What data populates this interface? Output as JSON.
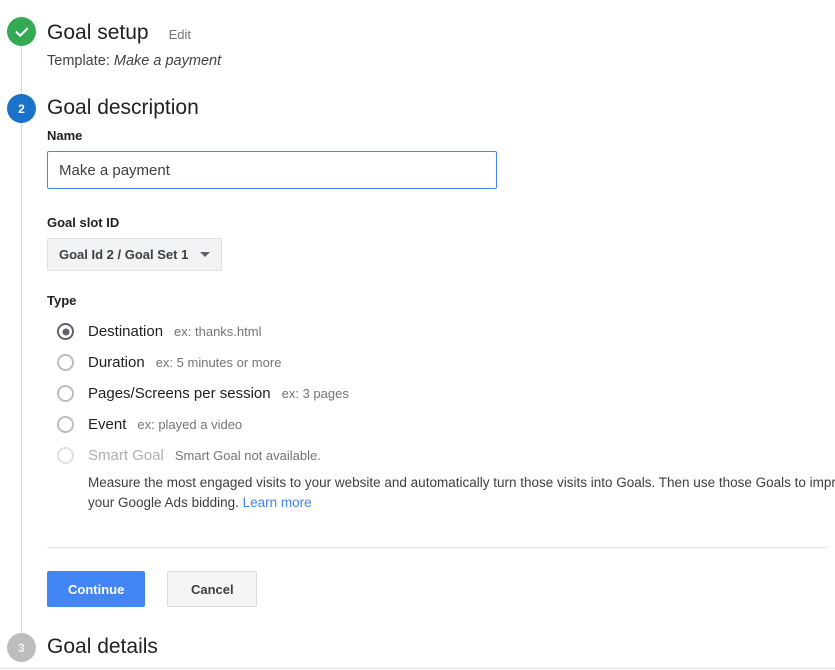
{
  "steps": {
    "setup": {
      "number": "1",
      "state": "completed",
      "title": "Goal setup",
      "edit_label": "Edit",
      "template_prefix": "Template:",
      "template_value": "Make a payment"
    },
    "description": {
      "number": "2",
      "state": "active",
      "title": "Goal description"
    },
    "details": {
      "number": "3",
      "state": "inactive",
      "title": "Goal details"
    }
  },
  "form": {
    "name": {
      "label": "Name",
      "value": "Make a payment",
      "placeholder": ""
    },
    "goal_slot": {
      "label": "Goal slot ID",
      "selected": "Goal Id 2 / Goal Set 1"
    },
    "type": {
      "label": "Type",
      "selected": "destination",
      "options": [
        {
          "id": "destination",
          "label": "Destination",
          "hint": "ex: thanks.html",
          "checked": true,
          "disabled": false
        },
        {
          "id": "duration",
          "label": "Duration",
          "hint": "ex: 5 minutes or more",
          "checked": false,
          "disabled": false
        },
        {
          "id": "pages",
          "label": "Pages/Screens per session",
          "hint": "ex: 3 pages",
          "checked": false,
          "disabled": false
        },
        {
          "id": "event",
          "label": "Event",
          "hint": "ex: played a video",
          "checked": false,
          "disabled": false
        },
        {
          "id": "smart",
          "label": "Smart Goal",
          "hint": "Smart Goal not available.",
          "checked": false,
          "disabled": true
        }
      ],
      "smart_goal_description": "Measure the most engaged visits to your website and automatically turn those visits into Goals. Then use those Goals to improve your Google Ads bidding.",
      "smart_goal_link": "Learn more"
    }
  },
  "actions": {
    "continue_label": "Continue",
    "cancel_label": "Cancel"
  },
  "colors": {
    "completed": "#34a853",
    "active": "#1a73c8",
    "inactive": "#bdbdbd",
    "primary_button": "#4285f4",
    "link": "#4285f4",
    "focus_border": "#4285f4"
  }
}
